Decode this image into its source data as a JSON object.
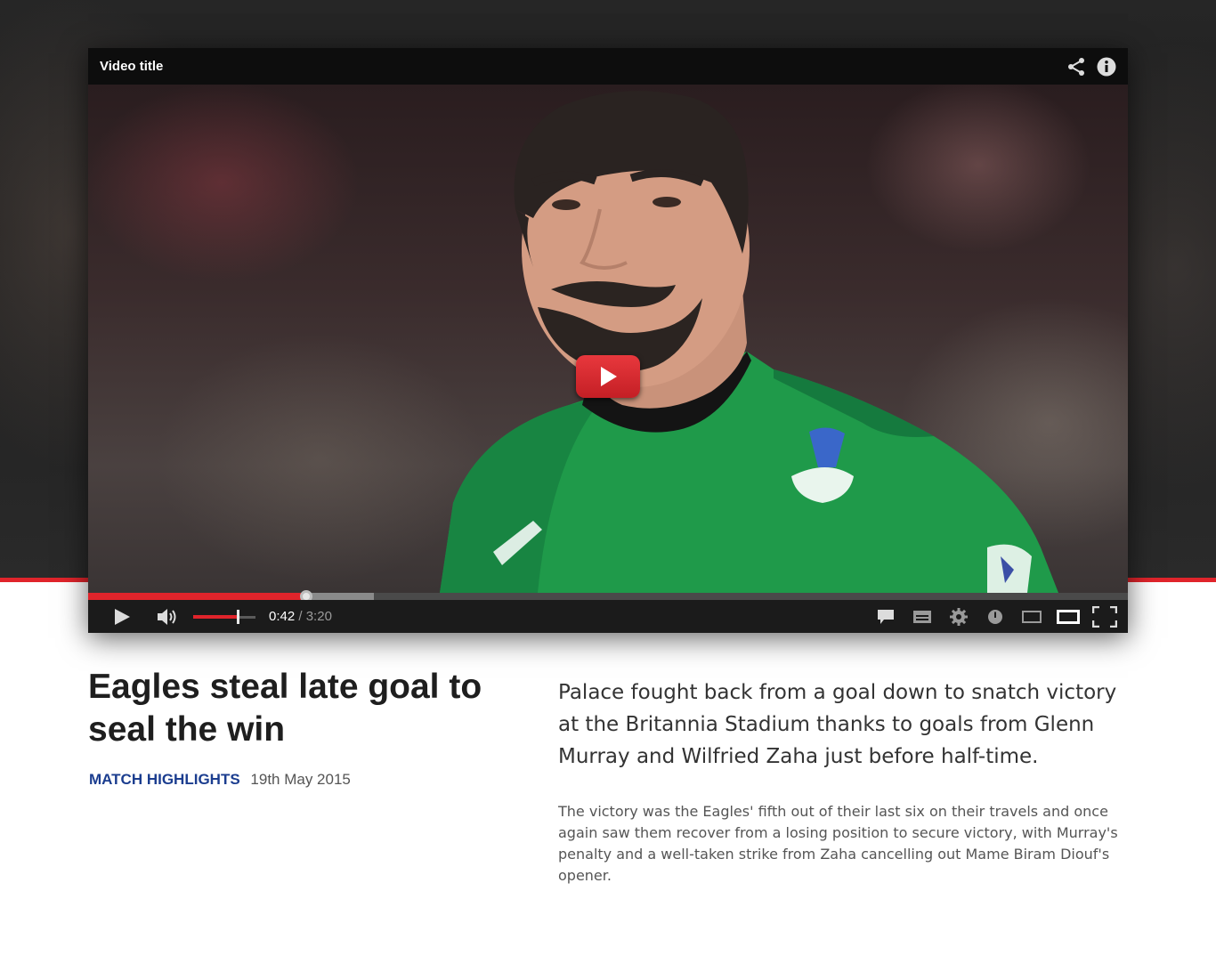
{
  "player": {
    "title": "Video title",
    "icons": {
      "share": "share-icon",
      "info": "info-icon",
      "big_play": "play-icon",
      "play": "play-icon",
      "volume": "volume-icon",
      "captions": "captions-icon",
      "subtitles": "subtitles-icon",
      "settings": "gear-icon",
      "watch_later": "clock-icon",
      "small_player": "small-player-icon",
      "large_player": "large-player-icon",
      "fullscreen": "fullscreen-icon"
    },
    "time_current": "0:42",
    "time_separator": "/",
    "time_duration": "3:20",
    "progress_played_fraction": 0.21,
    "progress_buffered_fraction": 0.275,
    "volume_fraction": 0.72,
    "accent_color": "#e0242b"
  },
  "article": {
    "headline": "Eagles steal late goal to seal the win",
    "category": "MATCH HIGHLIGHTS",
    "date": "19th May 2015",
    "lead": "Palace fought back from a goal down to snatch victory at the Britannia Stadium thanks to goals from Glenn Murray and Wilfried Zaha just before half-time.",
    "body": "The victory was the Eagles' fifth out of their last six on their travels and once again saw them recover from a losing position to secure victory, with Murray's penalty and a well-taken strike from Zaha cancelling out Mame Biram Diouf's opener."
  },
  "colors": {
    "accent": "#e0242b",
    "category": "#1b3d8f",
    "kit_green": "#1f9a4a"
  }
}
